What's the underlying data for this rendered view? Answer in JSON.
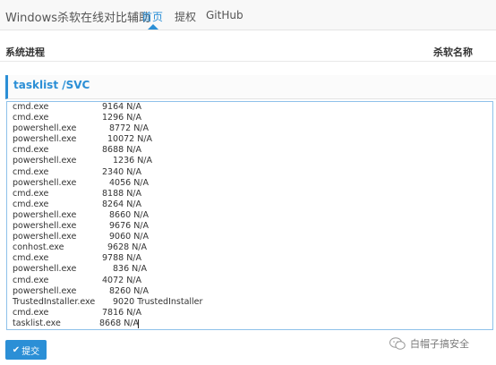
{
  "nav": {
    "brand": "Windows杀软在线对比辅助",
    "items": [
      {
        "label": "首页",
        "active": true
      },
      {
        "label": "提权",
        "active": false
      },
      {
        "label": "GitHub",
        "active": false
      }
    ]
  },
  "table": {
    "col1": "系统进程",
    "col2": "杀软名称"
  },
  "panel": {
    "title": "tasklist /SVC"
  },
  "processes": [
    {
      "name": "cmd.exe",
      "info": "9164 N/A"
    },
    {
      "name": "cmd.exe",
      "info": "1296 N/A"
    },
    {
      "name": "powershell.exe",
      "info": "8772 N/A"
    },
    {
      "name": "powershell.exe",
      "info": "10072 N/A"
    },
    {
      "name": "cmd.exe",
      "info": "8688 N/A"
    },
    {
      "name": "powershell.exe",
      "info": "1236 N/A"
    },
    {
      "name": "cmd.exe",
      "info": "2340 N/A"
    },
    {
      "name": "powershell.exe",
      "info": "4056 N/A"
    },
    {
      "name": "cmd.exe",
      "info": "8188 N/A"
    },
    {
      "name": "cmd.exe",
      "info": "8264 N/A"
    },
    {
      "name": "powershell.exe",
      "info": "8660 N/A"
    },
    {
      "name": "powershell.exe",
      "info": "9676 N/A"
    },
    {
      "name": "powershell.exe",
      "info": "9060 N/A"
    },
    {
      "name": "conhost.exe",
      "info": "9628 N/A"
    },
    {
      "name": "cmd.exe",
      "info": "9788 N/A"
    },
    {
      "name": "powershell.exe",
      "info": "836 N/A"
    },
    {
      "name": "cmd.exe",
      "info": "4072 N/A"
    },
    {
      "name": "powershell.exe",
      "info": "8260 N/A"
    },
    {
      "name": "TrustedInstaller.exe",
      "info": "9020 TrustedInstaller"
    },
    {
      "name": "cmd.exe",
      "info": "7816 N/A"
    },
    {
      "name": "tasklist.exe",
      "info": "8668 N/A"
    }
  ],
  "submit": {
    "label": "提交",
    "icon": "check-icon"
  },
  "watermark": {
    "text": "白帽子搞安全",
    "icon": "wechat-icon"
  },
  "colors": {
    "accent": "#2b8fd6"
  }
}
